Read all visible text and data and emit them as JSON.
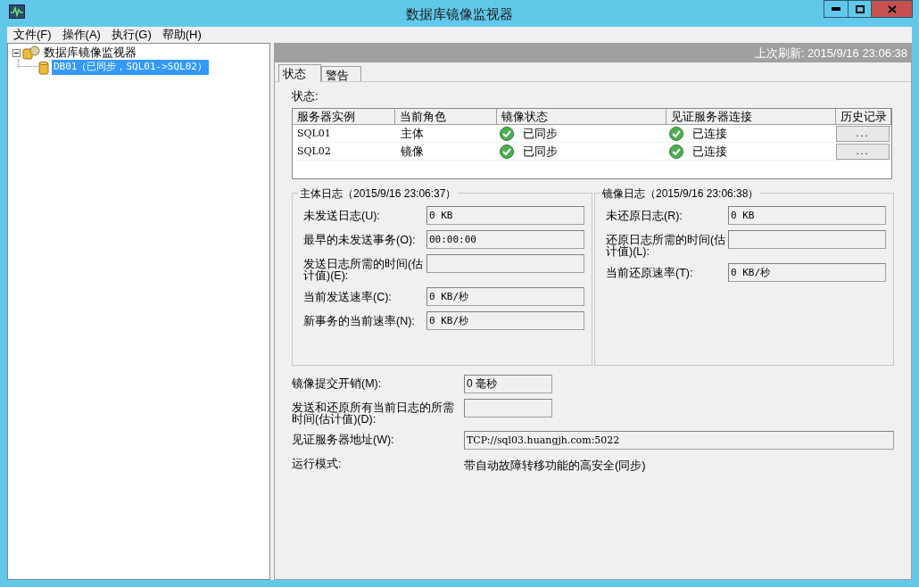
{
  "window": {
    "title": "数据库镜像监视器"
  },
  "menu": [
    "文件(F)",
    "操作(A)",
    "执行(G)",
    "帮助(H)"
  ],
  "tree": [
    {
      "label": "数据库镜像监视器",
      "expanded": true,
      "selected": false,
      "children": [
        {
          "label": "DB01（已同步，SQL01->SQL02）",
          "selected": true
        }
      ]
    }
  ],
  "header": {
    "last_refresh": "上次刷新: 2015/9/16 23:06:38"
  },
  "tabs": [
    {
      "label": "状态",
      "selected": true
    },
    {
      "label": "警告",
      "selected": false
    }
  ],
  "status_label": "状态:",
  "table": {
    "columns": [
      "服务器实例",
      "当前角色",
      "镜像状态",
      "见证服务器连接",
      "历史记录"
    ],
    "rows": [
      {
        "instance": "SQL01",
        "role": "主体",
        "mirror_state": "已同步",
        "witness": "已连接",
        "history_button": "..."
      },
      {
        "instance": "SQL02",
        "role": "镜像",
        "mirror_state": "已同步",
        "witness": "已连接",
        "history_button": "..."
      }
    ]
  },
  "principal_log": {
    "title": "主体日志（2015/9/16 23:06:37）",
    "fields": [
      {
        "label": "未发送日志(U):",
        "value": "0 KB"
      },
      {
        "label": "最早的未发送事务(O):",
        "value": "00:00:00"
      },
      {
        "label": "发送日志所需的时间(估计值)(E):"
      },
      {
        "label": "当前发送速率(C):",
        "value": "0 KB/秒"
      },
      {
        "label": "新事务的当前速率(N):",
        "value": "0 KB/秒"
      }
    ]
  },
  "mirror_log": {
    "title": "镜像日志（2015/9/16 23:06:38）",
    "fields": [
      {
        "label": "未还原日志(R):",
        "value": "0 KB"
      },
      {
        "label": "还原日志所需的时间(估计值)(L):"
      },
      {
        "label": "当前还原速率(T):",
        "value": "0 KB/秒"
      }
    ]
  },
  "details": [
    {
      "kind": "short_field",
      "label": "镜像提交开销(M):",
      "value": "0 毫秒"
    },
    {
      "kind": "short_field",
      "label": "发送和还原所有当前日志的所需时间(估计值)(D):"
    },
    {
      "kind": "wide_field",
      "label": "见证服务器地址(W):",
      "value": "TCP://sql03.huangjh.com:5022"
    },
    {
      "kind": "text",
      "label": "运行模式:",
      "value": "带自动故障转移功能的高安全(同步)"
    }
  ]
}
